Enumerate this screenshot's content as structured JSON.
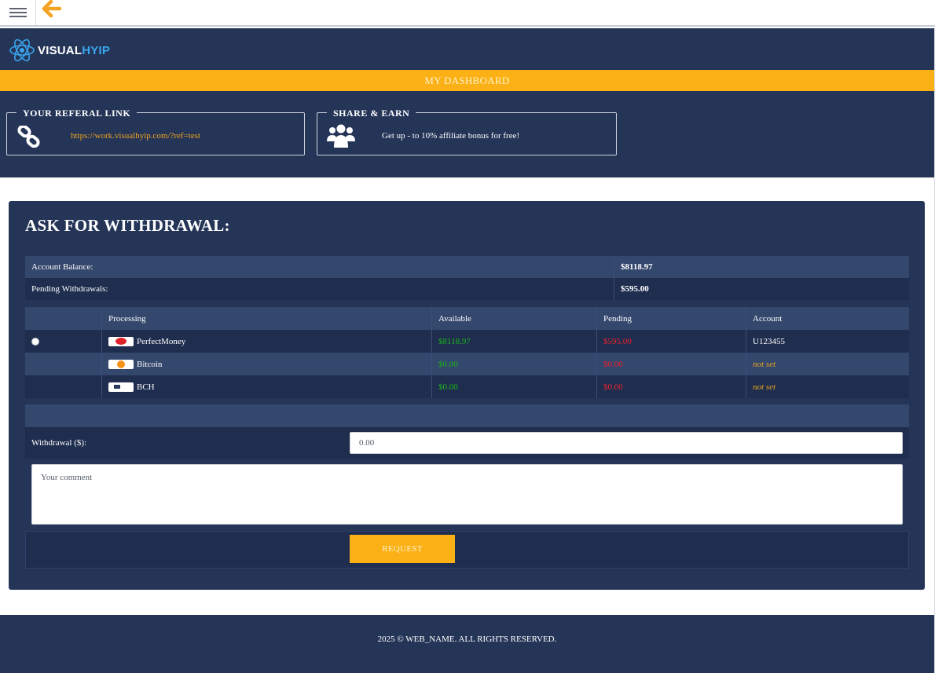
{
  "topbar": {
    "menu_icon": "hamburger-menu-icon",
    "back_icon": "arrow-left-icon",
    "back_color": "#f4a422"
  },
  "brand": {
    "name_part1": "VISUAL",
    "name_part2": "HYIP",
    "accent": "#3aa6ee"
  },
  "dashboard_label": "MY DASHBOARD",
  "referral": {
    "title": "YOUR REFERAL LINK",
    "link": "https://work.visualhyip.com/?ref=test",
    "icon": "link-icon"
  },
  "share": {
    "title": "SHARE & EARN",
    "text": "Get up - to 10% affiliate bonus for free!",
    "icon": "users-icon"
  },
  "withdrawal": {
    "title": "ASK FOR WITHDRAWAL:",
    "balance_label": "Account Balance:",
    "balance_value": "$8118.97",
    "pending_label": "Pending Withdrawals:",
    "pending_value": "$595.00",
    "columns": [
      "Processing",
      "Available",
      "Pending",
      "Account"
    ],
    "processors": [
      {
        "name": "PerfectMoney",
        "available": "$8118.97",
        "pending": "$595.00",
        "account": "U123455",
        "account_set": true,
        "selected": false
      },
      {
        "name": "Bitcoin",
        "available": "$0.00",
        "pending": "$0.00",
        "account": "not set",
        "account_set": false
      },
      {
        "name": "BCH",
        "available": "$0.00",
        "pending": "$0.00",
        "account": "not set",
        "account_set": false
      }
    ],
    "amount_label": "Withdrawal ($):",
    "amount_value": "0.00",
    "comment_placeholder": "Your comment",
    "request_label": "REQUEST"
  },
  "footer": {
    "text": "2025 © WEB_NAME. ALL RIGHTS RESERVED."
  },
  "colors": {
    "navy": "#253558",
    "accent": "#fbb016",
    "available": "#19b319",
    "pending": "#f0202a",
    "notset": "#f0a51c"
  }
}
